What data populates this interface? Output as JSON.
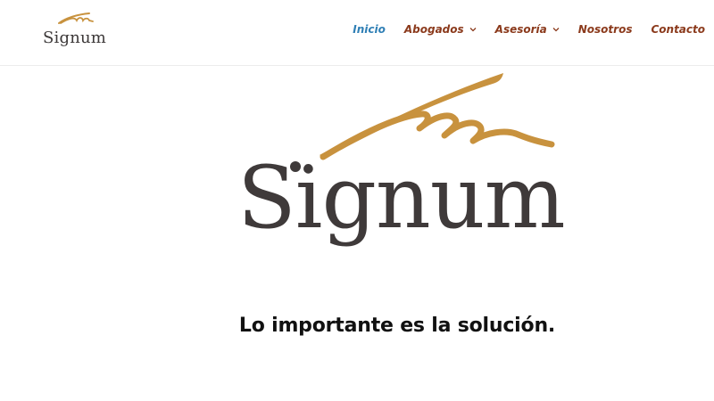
{
  "header": {
    "logo_text": "Signum"
  },
  "nav": {
    "items": [
      {
        "label": "Inicio",
        "active": true,
        "dropdown": false
      },
      {
        "label": "Abogados",
        "active": false,
        "dropdown": true
      },
      {
        "label": "Asesoría",
        "active": false,
        "dropdown": true
      },
      {
        "label": "Nosotros",
        "active": false,
        "dropdown": false
      },
      {
        "label": "Contacto",
        "active": false,
        "dropdown": false
      }
    ]
  },
  "hero": {
    "logo_text": "Signum",
    "tagline": "Lo importante es la solución."
  },
  "colors": {
    "nav_text": "#8b3a1c",
    "nav_active": "#2f7fb5",
    "logo_gold": "#c8923e",
    "logo_text": "#3f3a3a"
  },
  "icons": {
    "dropdown": "chevron-down-icon",
    "signature": "signature-swoosh-icon"
  }
}
